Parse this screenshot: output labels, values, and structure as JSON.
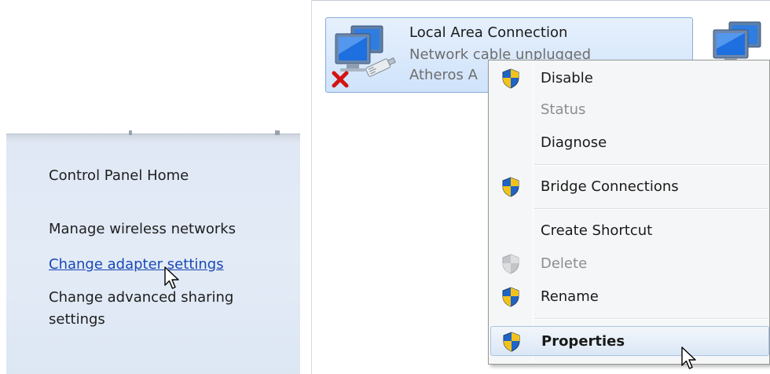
{
  "left_pane": {
    "links": [
      {
        "label": "Control Panel Home"
      },
      {
        "label": "Manage wireless networks"
      },
      {
        "label": "Change adapter settings",
        "active": true
      },
      {
        "label": "Change advanced sharing"
      },
      {
        "label": "settings"
      }
    ]
  },
  "adapter": {
    "name": "Local Area Connection",
    "status": "Network cable unplugged",
    "device": "Atheros A",
    "status_icon": "red-x-icon"
  },
  "context_menu": {
    "items": [
      {
        "label": "Disable",
        "shield": true,
        "disabled": false
      },
      {
        "label": "Status",
        "shield": false,
        "disabled": true
      },
      {
        "label": "Diagnose",
        "shield": false,
        "disabled": false
      },
      {
        "label": "Bridge Connections",
        "shield": true,
        "disabled": false
      },
      {
        "label": "Create Shortcut",
        "shield": false,
        "disabled": false
      },
      {
        "label": "Delete",
        "shield": true,
        "disabled": true
      },
      {
        "label": "Rename",
        "shield": true,
        "disabled": false
      },
      {
        "label": "Properties",
        "shield": true,
        "disabled": false,
        "default": true,
        "hover": true
      }
    ]
  },
  "colors": {
    "link_active": "#1a48b5",
    "tile_border": "#84acdd",
    "menu_bg": "#f5f6f7",
    "disabled_text": "#8d8d8d"
  }
}
